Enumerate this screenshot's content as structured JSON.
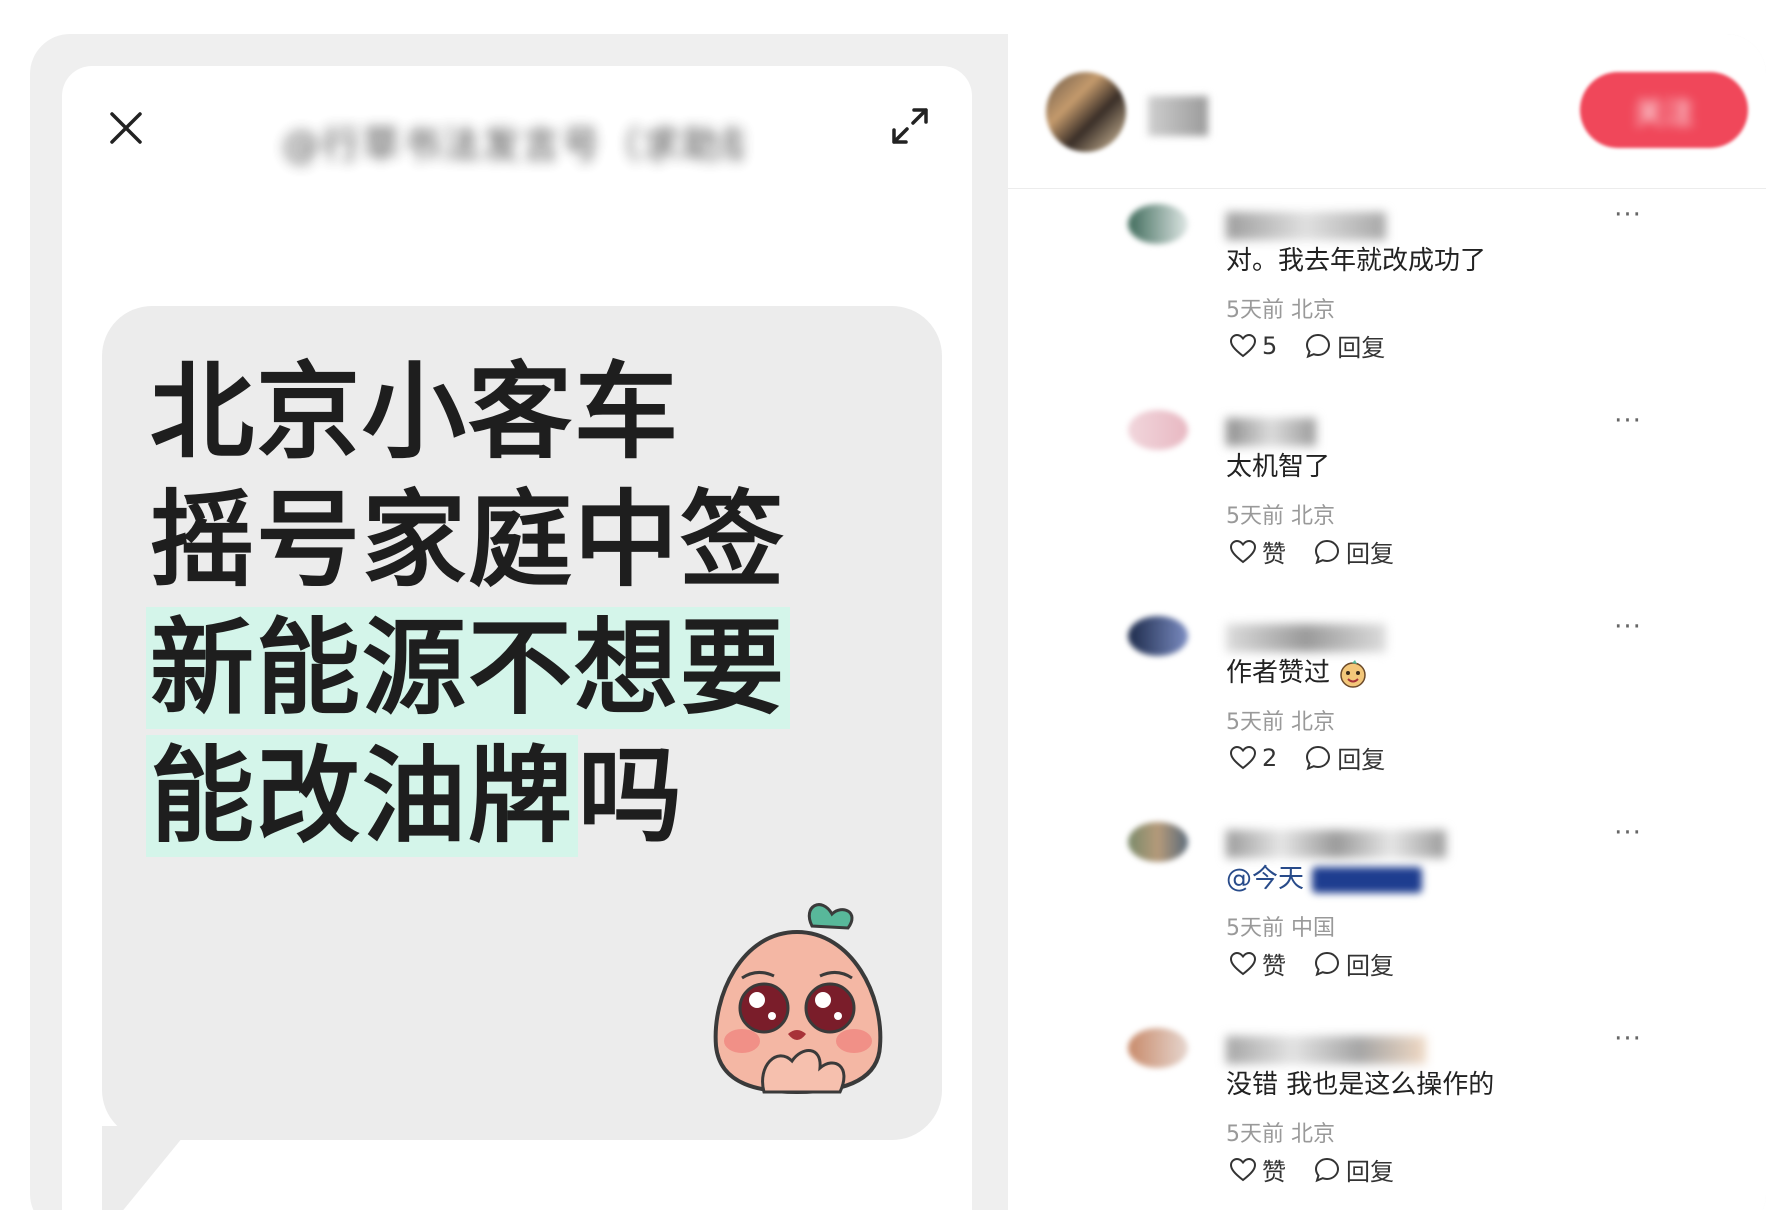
{
  "post": {
    "title": "@行草书法发言号（求助版）",
    "headline_lines": [
      "北京小客车",
      "摇号家庭中签"
    ],
    "headline_highlight_1": "新能源不想要",
    "headline_highlight_2": "能改油牌",
    "headline_tail": "吗"
  },
  "header": {
    "author_name": "■",
    "follow_label": "关注"
  },
  "comments": [
    {
      "text": "对。我去年就改成功了",
      "meta": "5天前 北京",
      "like": "5",
      "reply": "回复",
      "more": "···"
    },
    {
      "text": "太机智了",
      "meta": "5天前 北京",
      "like": "赞",
      "reply": "回复",
      "more": "···"
    },
    {
      "text": "作者赞过",
      "meta": "5天前 北京",
      "like": "2",
      "reply": "回复",
      "more": "···"
    },
    {
      "text": "@今天",
      "meta": "5天前 中国",
      "like": "赞",
      "reply": "回复",
      "more": "···"
    },
    {
      "text": "没错 我也是这么操作的",
      "meta": "5天前 北京",
      "like": "赞",
      "reply": "回复",
      "more": "···"
    }
  ],
  "colors": {
    "follow": "#f0475a",
    "highlight": "#d4f5ea",
    "mention": "#284b8a"
  },
  "icons": [
    "close-icon",
    "expand-icon",
    "heart-icon",
    "comment-icon",
    "more-icon"
  ]
}
